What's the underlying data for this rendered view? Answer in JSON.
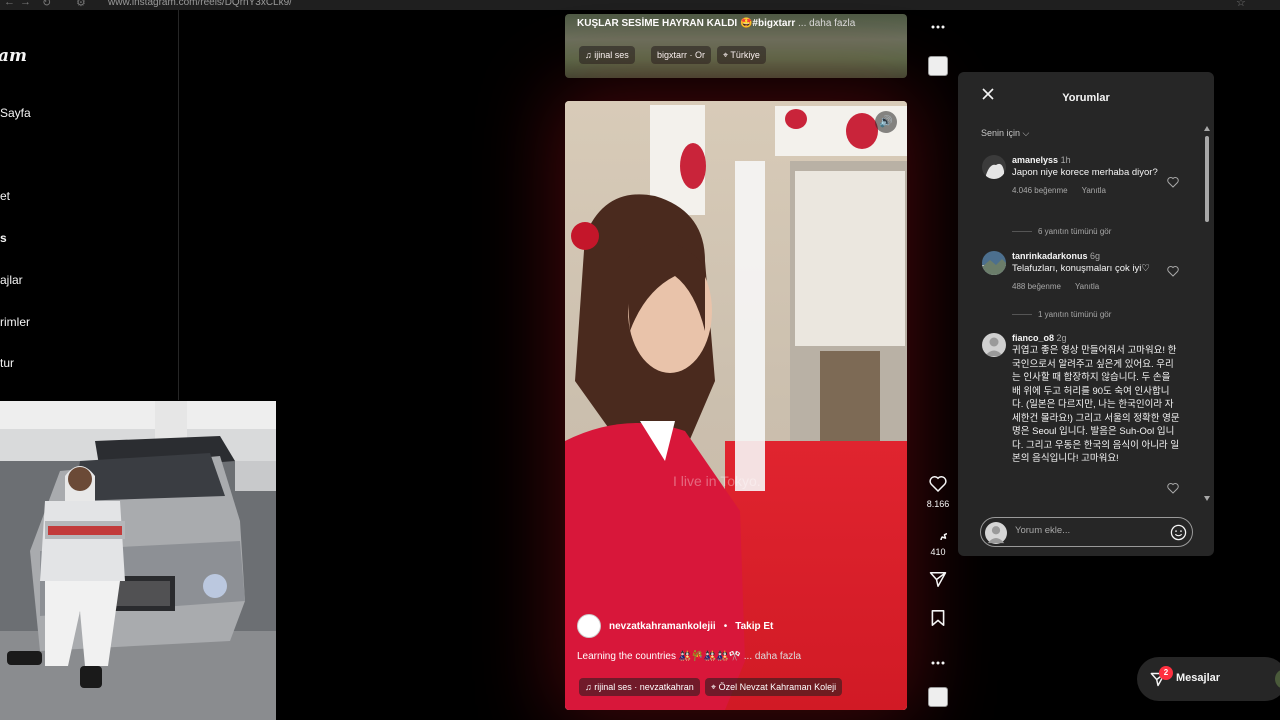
{
  "browser": {
    "url": "www.instagram.com/reels/DQrnY3xCLk9/"
  },
  "sidebar": {
    "logo": "am",
    "items": [
      {
        "label": "Sayfa"
      },
      {
        "label": "et"
      },
      {
        "label": "s"
      },
      {
        "label": "ajlar"
      },
      {
        "label": "rimler"
      },
      {
        "label": "tur"
      }
    ]
  },
  "prev_reel": {
    "caption": "KUŞLAR SESİME HAYRAN KALDI 🤩#bigxtarr",
    "more": "... daha fazla",
    "audio": "ijinal ses",
    "account": "bigxtarr · Or",
    "location": "Türkiye"
  },
  "reel": {
    "watermark": "I live in Tokyo.",
    "account": "nevzatkahramankolejii",
    "separator": "•",
    "follow": "Takip Et",
    "caption": "Learning the countries 🎎🎋🎎🎎🎌",
    "more": "... daha fazla",
    "audio": "rijinal ses · nevzatkahran",
    "location": "Özel Nevzat Kahraman Koleji"
  },
  "actions": {
    "likes": "8.166",
    "comments": "410"
  },
  "comments_panel": {
    "title": "Yorumlar",
    "sort": "Senin için",
    "input_placeholder": "Yorum ekle...",
    "comments": [
      {
        "user": "amanelyss",
        "time": "1h",
        "text": "Japon niye korece merhaba diyor?",
        "likes": "4.046 beğenme",
        "reply": "Yanıtla",
        "replies": "6 yanıtın tümünü gör"
      },
      {
        "user": "tanrinkadarkonus",
        "time": "6g",
        "text": "Telafuzları, konuşmaları çok iyi♡",
        "likes": "488 beğenme",
        "reply": "Yanıtla",
        "replies": "1 yanıtın tümünü gör"
      },
      {
        "user": "fianco_o8",
        "time": "2g",
        "text": "귀엽고 좋은 영상 만들어줘서 고마워요! 한국인으로서 알려주고 싶은게 있어요. 우리는 인사할 때 합장하지 않습니다. 두 손을 배 위에 두고 허리를 90도 숙여 인사합니다. (일본은 다르지만, 나는 한국인이라 자세한건 몰라요!) 그리고 서울의 정확한 영문명은 Seoul 입니다. 발음은 Suh-Ool 입니다. 그리고 우동은 한국의 음식이 아니라 일본의 음식입니다! 고마워요!"
      }
    ]
  },
  "messages": {
    "label": "Mesajlar",
    "badge": "2"
  },
  "colors": {
    "background": "#000000",
    "panel": "#262626",
    "badge": "#ff3040",
    "flag_red": "#d11a25"
  }
}
